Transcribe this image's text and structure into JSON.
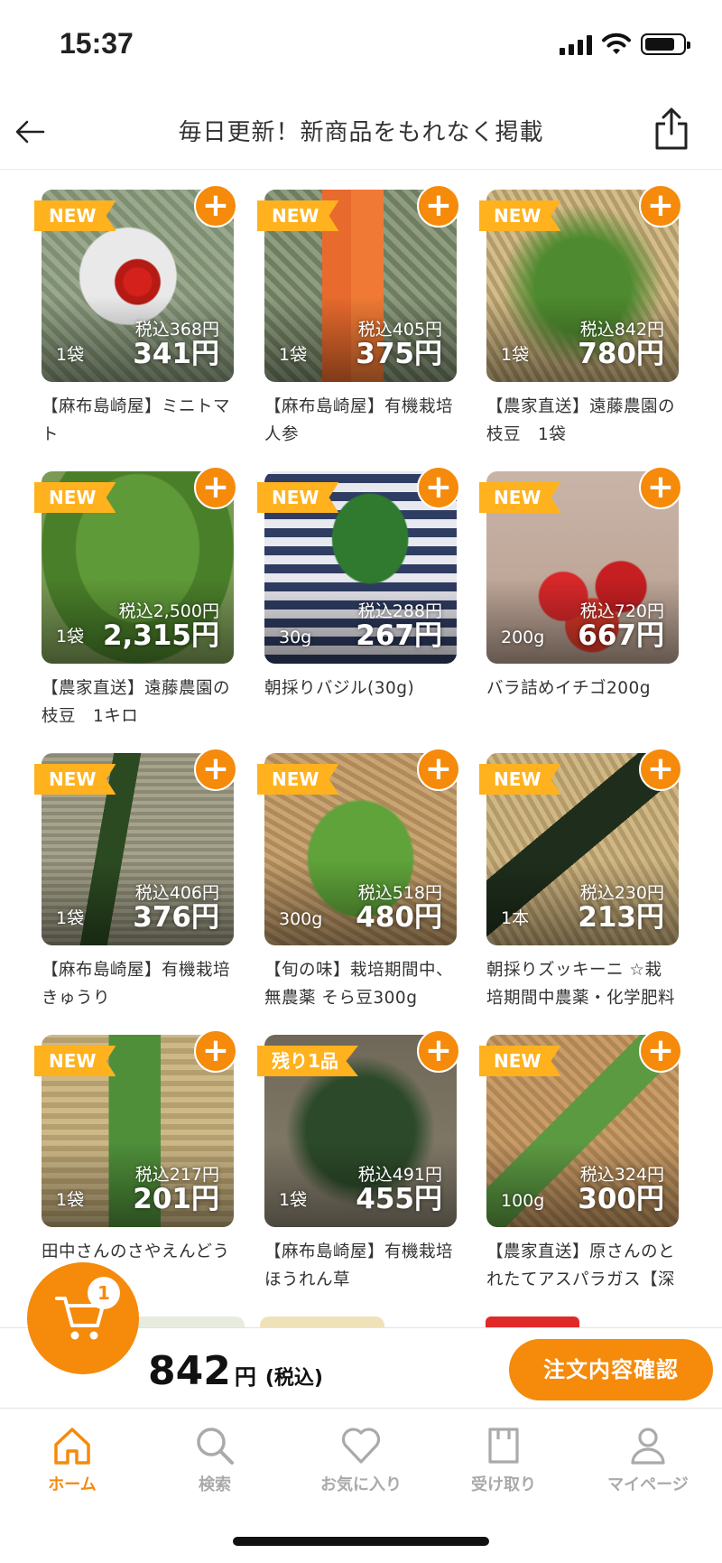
{
  "status_bar": {
    "time": "15:37"
  },
  "header": {
    "title": "毎日更新！新商品をもれなく掲載"
  },
  "products": [
    {
      "badge": "NEW",
      "tax_in": "税込368円",
      "qty": "1袋",
      "price": "341円",
      "name": "【麻布島崎屋】ミニトマト",
      "img": "tomato"
    },
    {
      "badge": "NEW",
      "tax_in": "税込405円",
      "qty": "1袋",
      "price": "375円",
      "name": "【麻布島崎屋】有機栽培人参",
      "img": "carrot"
    },
    {
      "badge": "NEW",
      "tax_in": "税込842円",
      "qty": "1袋",
      "price": "780円",
      "name": "【農家直送】遠藤農園の枝豆　1袋",
      "img": "edamame"
    },
    {
      "badge": "NEW",
      "tax_in": "税込2,500円",
      "qty": "1袋",
      "price": "2,315円",
      "name": "【農家直送】遠藤農園の枝豆　1キロ",
      "img": "edamame2"
    },
    {
      "badge": "NEW",
      "tax_in": "税込288円",
      "qty": "30g",
      "price": "267円",
      "name": "朝採りバジル(30g)",
      "img": "basil"
    },
    {
      "badge": "NEW",
      "tax_in": "税込720円",
      "qty": "200g",
      "price": "667円",
      "name": "バラ詰めイチゴ200g",
      "img": "strawberry"
    },
    {
      "badge": "NEW",
      "tax_in": "税込406円",
      "qty": "1袋",
      "price": "376円",
      "name": "【麻布島崎屋】有機栽培きゅうり",
      "img": "cucumber"
    },
    {
      "badge": "NEW",
      "tax_in": "税込518円",
      "qty": "300g",
      "price": "480円",
      "name": "【旬の味】栽培期間中、無農薬 そら豆300g",
      "img": "favabean"
    },
    {
      "badge": "NEW",
      "tax_in": "税込230円",
      "qty": "1本",
      "price": "213円",
      "name": "朝採りズッキーニ ☆栽培期間中農薬・化学肥料",
      "img": "zucchini"
    },
    {
      "badge": "NEW",
      "tax_in": "税込217円",
      "qty": "1袋",
      "price": "201円",
      "name": "田中さんのさやえんどう",
      "img": "peas"
    },
    {
      "badge": "残り1品",
      "tax_in": "税込491円",
      "qty": "1袋",
      "price": "455円",
      "name": "【麻布島崎屋】有機栽培ほうれん草",
      "img": "spinach"
    },
    {
      "badge": "NEW",
      "tax_in": "税込324円",
      "qty": "100g",
      "price": "300円",
      "name": "【農家直送】原さんのとれたてアスパラガス【深",
      "img": "asparagus"
    }
  ],
  "cart": {
    "count": "1",
    "total": "842",
    "unit": "円",
    "tax_note": "(税込)",
    "confirm_label": "注文内容確認"
  },
  "tabs": [
    {
      "label": "ホーム",
      "icon": "home-icon",
      "active": true
    },
    {
      "label": "検索",
      "icon": "search-icon",
      "active": false
    },
    {
      "label": "お気に入り",
      "icon": "heart-icon",
      "active": false
    },
    {
      "label": "受け取り",
      "icon": "bag-icon",
      "active": false
    },
    {
      "label": "マイページ",
      "icon": "person-icon",
      "active": false
    }
  ],
  "colors": {
    "accent": "#f58a0b",
    "badge": "#ffb21e"
  }
}
